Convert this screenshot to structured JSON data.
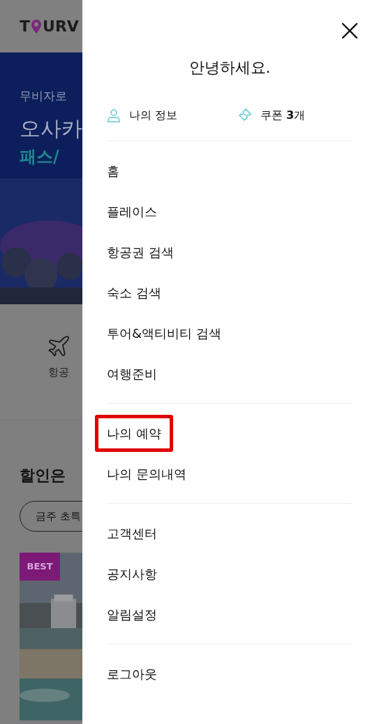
{
  "background": {
    "logo": {
      "before": "T",
      "after": "URV"
    },
    "banner": {
      "subtitle": "무비자로",
      "title": "오사카",
      "highlight": "패스/"
    },
    "quick_menu": [
      {
        "label": "항공"
      }
    ],
    "section": {
      "heading": "할인은",
      "chip": "금주 초특",
      "badge": "BEST"
    }
  },
  "drawer": {
    "greeting": "안녕하세요.",
    "profile": {
      "my_info": "나의 정보",
      "coupon": "쿠폰 **3**개"
    },
    "menu_groups": [
      [
        {
          "label": "홈",
          "highlighted": false
        },
        {
          "label": "플레이스",
          "highlighted": false
        },
        {
          "label": "항공권 검색",
          "highlighted": false
        },
        {
          "label": "숙소 검색",
          "highlighted": false
        },
        {
          "label": "투어&액티비티 검색",
          "highlighted": false
        },
        {
          "label": "여행준비",
          "highlighted": false
        }
      ],
      [
        {
          "label": "나의 예약",
          "highlighted": true
        },
        {
          "label": "나의 문의내역",
          "highlighted": false
        }
      ],
      [
        {
          "label": "고객센터",
          "highlighted": false
        },
        {
          "label": "공지사항",
          "highlighted": false
        },
        {
          "label": "알림설정",
          "highlighted": false
        }
      ],
      [
        {
          "label": "로그아웃",
          "highlighted": false
        }
      ]
    ]
  }
}
